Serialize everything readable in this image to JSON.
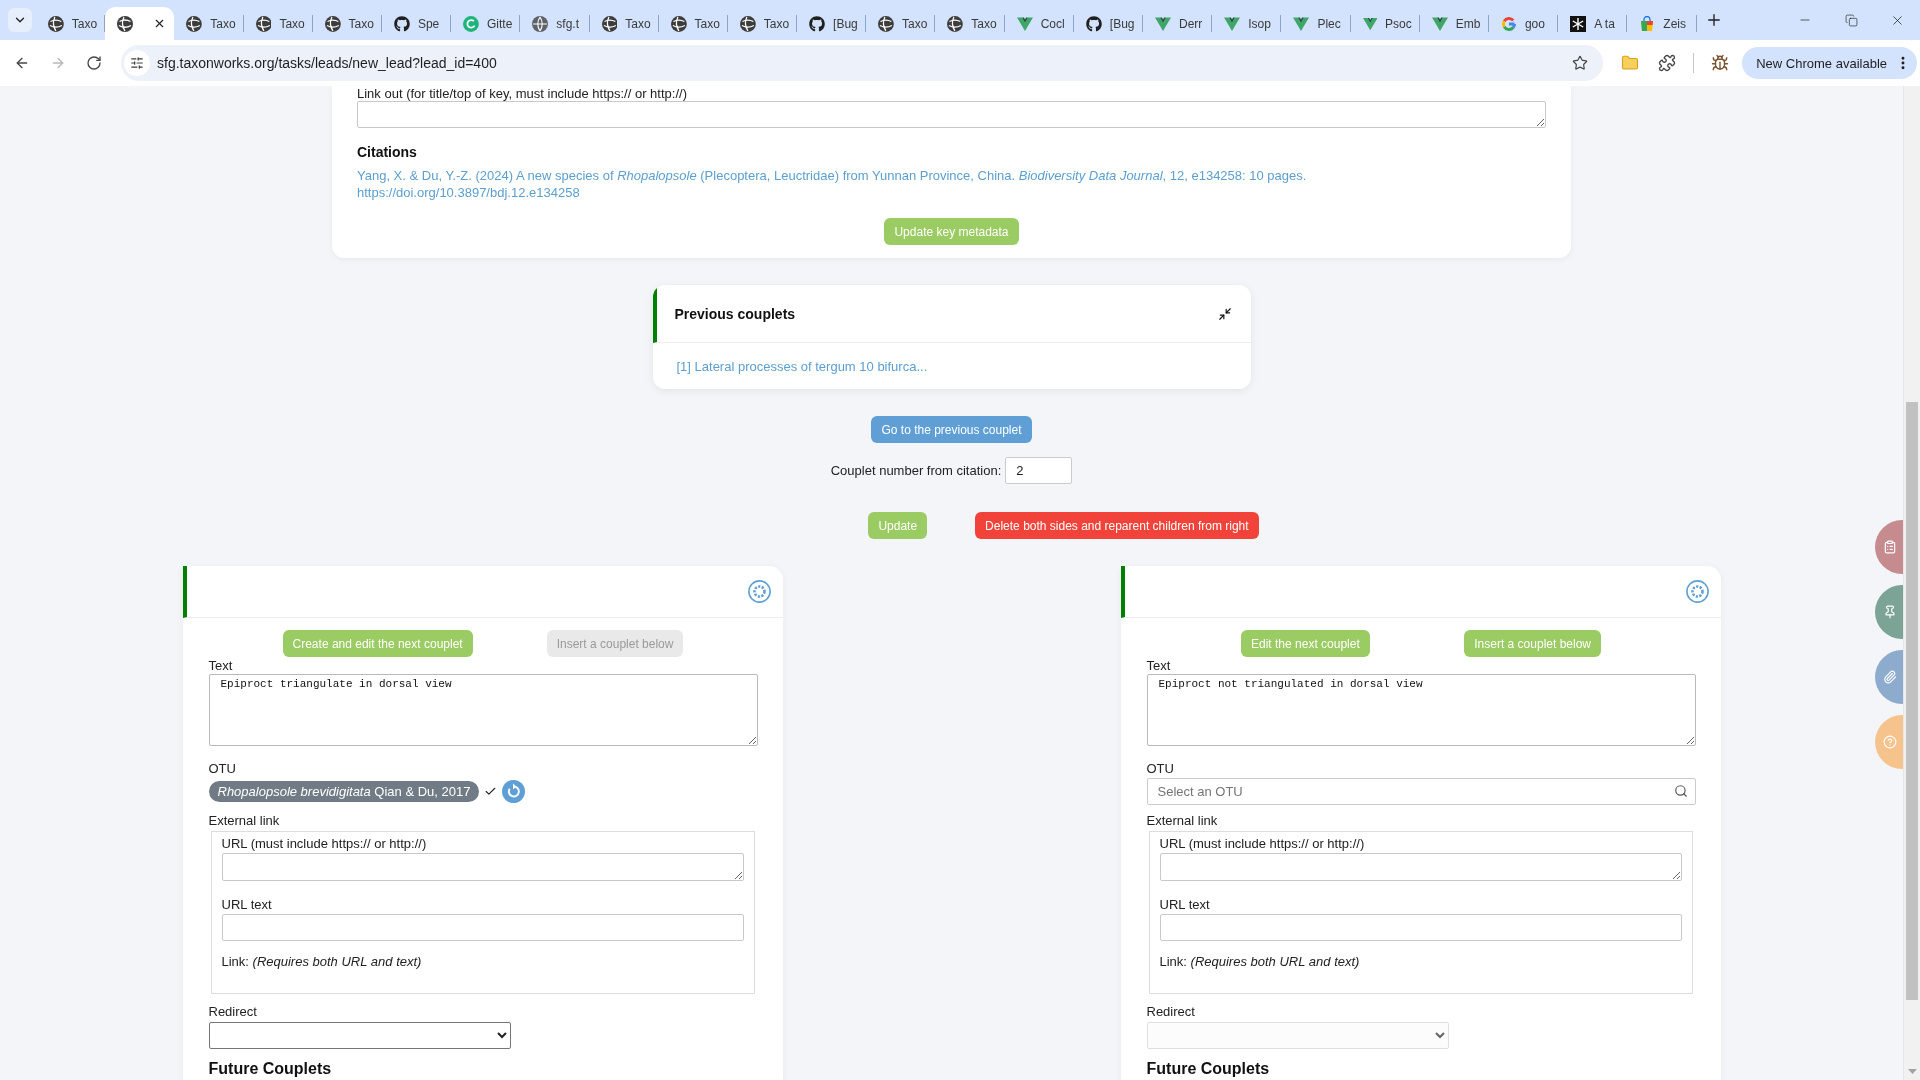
{
  "browser": {
    "tabs": [
      {
        "label": "Taxo",
        "kind": "taxonworks",
        "selected": false
      },
      {
        "kind": "taxonworks",
        "selected": true
      },
      {
        "label": "Taxo",
        "kind": "taxonworks",
        "selected": false
      },
      {
        "label": "Taxo",
        "kind": "taxonworks",
        "selected": false
      },
      {
        "label": "Taxo",
        "kind": "taxonworks",
        "selected": false
      },
      {
        "label": "Spe",
        "kind": "github",
        "selected": false
      },
      {
        "label": "Gitte",
        "kind": "gitter",
        "selected": false
      },
      {
        "label": "sfg.t",
        "kind": "globe",
        "selected": false
      },
      {
        "label": "Taxo",
        "kind": "taxonworks",
        "selected": false
      },
      {
        "label": "Taxo",
        "kind": "taxonworks",
        "selected": false
      },
      {
        "label": "Taxo",
        "kind": "taxonworks",
        "selected": false
      },
      {
        "label": "[Bug",
        "kind": "github",
        "selected": false
      },
      {
        "label": "Taxo",
        "kind": "taxonworks",
        "selected": false
      },
      {
        "label": "Taxo",
        "kind": "taxonworks",
        "selected": false
      },
      {
        "label": "Cocl",
        "kind": "v",
        "selected": false
      },
      {
        "label": "[Bug",
        "kind": "github",
        "selected": false
      },
      {
        "label": "Derr",
        "kind": "v",
        "selected": false
      },
      {
        "label": "Isop",
        "kind": "v",
        "selected": false
      },
      {
        "label": "Plec",
        "kind": "v",
        "selected": false
      },
      {
        "label": "Psoc",
        "kind": "v",
        "selected": false
      },
      {
        "label": "Emb",
        "kind": "v",
        "selected": false
      },
      {
        "label": "goo",
        "kind": "google",
        "selected": false
      },
      {
        "label": "A ta",
        "kind": "snowflake",
        "selected": false
      },
      {
        "label": "Zeis",
        "kind": "bag",
        "selected": false
      }
    ],
    "forward_disabled": true,
    "address": "sfg.taxonworks.org/tasks/leads/new_lead?lead_id=400",
    "update_button": "New Chrome available"
  },
  "key_metadata": {
    "link_out_label": "Link out (for title/top of key, must include https:// or http://)",
    "citations_heading": "Citations",
    "citation": "Yang, X. & Du, Y.-Z. (2024) A new species of *Rhopalopsole* (Plecoptera, Leuctridae) from Yunnan Province, China. *Biodiversity Data Journal*, 12, e134258: 10 pages. https://doi.org/10.3897/bdj.12.e134258",
    "button": "Update key metadata"
  },
  "previous_couplets": {
    "title": "Previous couplets",
    "expanded": true,
    "items": [
      "[1] Lateral processes of tergum 10 bifurca..."
    ]
  },
  "previous_button": "Go to the previous couplet",
  "couplet_number": {
    "label": "Couplet number from citation:",
    "value": "2"
  },
  "actions": [
    {
      "label": "Update",
      "kind": "update"
    },
    {
      "label": "Delete both sides and reparent children from right",
      "kind": "delete"
    }
  ],
  "sides": [
    {
      "buttons": [
        {
          "label": "Create and edit the next couplet",
          "disabled": false
        },
        {
          "label": "Insert a couplet below",
          "disabled": true
        }
      ],
      "text_label": "Text",
      "text": "Epiproct triangulate in dorsal view",
      "otu_label": "OTU",
      "otu": {
        "kind": "chosen",
        "name": "*Rhopalopsole brevidigitata* Qian & Du, 2017"
      },
      "external_link_label": "External link",
      "url_label": "URL (must include https:// or http://)",
      "url_text_label": "URL text",
      "link_note": "Link: *(Requires both URL and text)*",
      "redirect_label": "Redirect",
      "redirect_disabled": false,
      "future_heading": "Future Couplets"
    },
    {
      "buttons": [
        {
          "label": "Edit the next couplet",
          "disabled": false
        },
        {
          "label": "Insert a couplet below",
          "disabled": false
        }
      ],
      "text_label": "Text",
      "text": "Epiproct not triangulated in dorsal view",
      "otu_label": "OTU",
      "otu": {
        "kind": "search",
        "placeholder": "Select an OTU"
      },
      "external_link_label": "External link",
      "url_label": "URL (must include https:// or http://)",
      "url_text_label": "URL text",
      "link_note": "Link: *(Requires both URL and text)*",
      "redirect_label": "Redirect",
      "redirect_disabled": true,
      "future_heading": "Future Couplets"
    }
  ]
}
